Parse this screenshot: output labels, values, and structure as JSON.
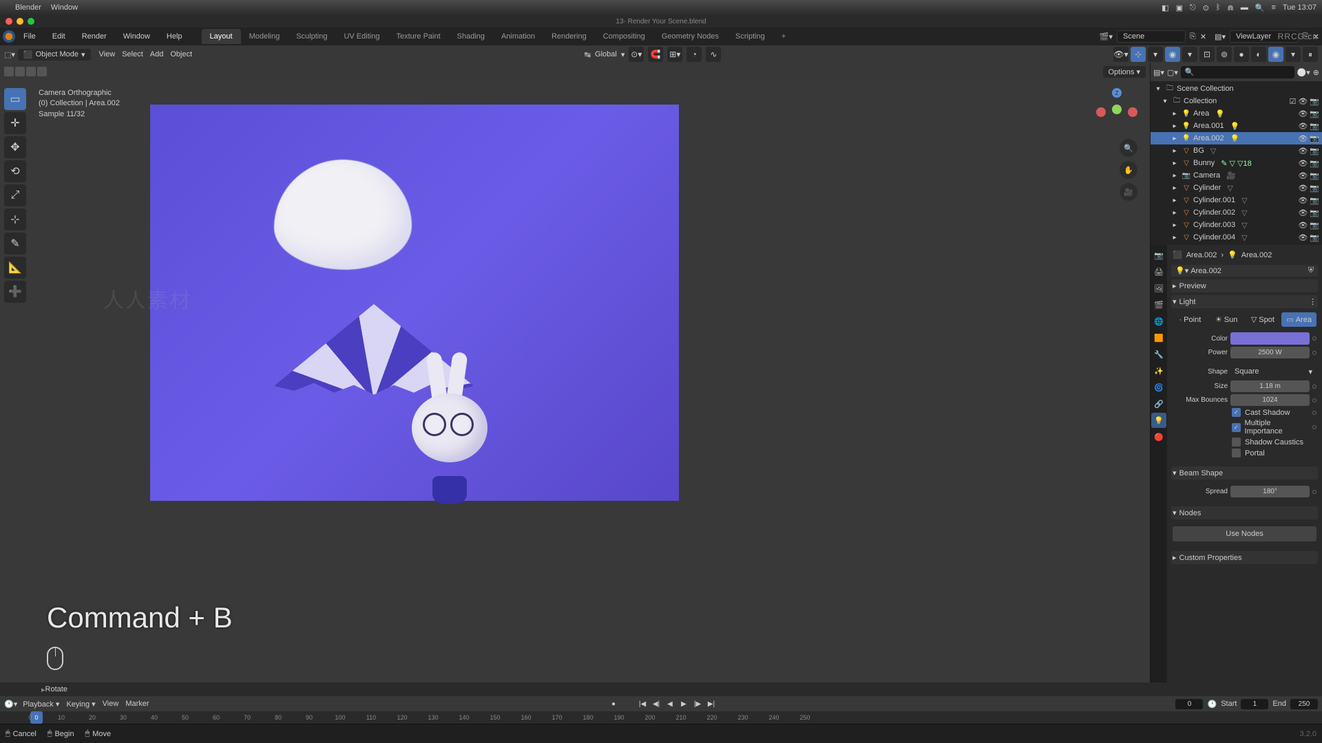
{
  "mac": {
    "app": "Blender",
    "window": "Window",
    "clock": "Tue 13:07"
  },
  "titlebar": {
    "filename": "13- Render Your Scene.blend"
  },
  "menus": {
    "file": "File",
    "edit": "Edit",
    "render": "Render",
    "window": "Window",
    "help": "Help"
  },
  "workspaces": [
    "Layout",
    "Modeling",
    "Sculpting",
    "UV Editing",
    "Texture Paint",
    "Shading",
    "Animation",
    "Rendering",
    "Compositing",
    "Geometry Nodes",
    "Scripting"
  ],
  "active_workspace": "Layout",
  "scene_field": "Scene",
  "viewlayer_field": "ViewLayer",
  "header": {
    "mode": "Object Mode",
    "view": "View",
    "select": "Select",
    "add": "Add",
    "object": "Object",
    "orientation": "Global",
    "options": "Options"
  },
  "overlay": {
    "line1": "Camera Orthographic",
    "line2": "(0) Collection | Area.002",
    "line3": "Sample 11/32"
  },
  "shortcut": "Command + B",
  "outliner": {
    "root": "Scene Collection",
    "collection": "Collection",
    "items": [
      {
        "name": "Area",
        "type": "light"
      },
      {
        "name": "Area.001",
        "type": "light"
      },
      {
        "name": "Area.002",
        "type": "light",
        "selected": true
      },
      {
        "name": "BG",
        "type": "mesh"
      },
      {
        "name": "Bunny",
        "type": "mesh",
        "extra": "18"
      },
      {
        "name": "Camera",
        "type": "camera"
      },
      {
        "name": "Cylinder",
        "type": "mesh"
      },
      {
        "name": "Cylinder.001",
        "type": "mesh"
      },
      {
        "name": "Cylinder.002",
        "type": "mesh"
      },
      {
        "name": "Cylinder.003",
        "type": "mesh"
      },
      {
        "name": "Cylinder.004",
        "type": "mesh"
      }
    ]
  },
  "props": {
    "breadcrumb1": "Area.002",
    "breadcrumb2": "Area.002",
    "data_name": "Area.002",
    "panels": {
      "preview": "Preview",
      "light": "Light",
      "beam": "Beam Shape",
      "nodes": "Nodes",
      "custom": "Custom Properties"
    },
    "light_types": [
      "Point",
      "Sun",
      "Spot",
      "Area"
    ],
    "active_light_type": "Area",
    "color_label": "Color",
    "power_label": "Power",
    "power_value": "2500 W",
    "shape_label": "Shape",
    "shape_value": "Square",
    "size_label": "Size",
    "size_value": "1.18 m",
    "bounces_label": "Max Bounces",
    "bounces_value": "1024",
    "cast_shadow": "Cast Shadow",
    "multiple_importance": "Multiple Importance",
    "shadow_caustics": "Shadow Caustics",
    "portal": "Portal",
    "spread_label": "Spread",
    "spread_value": "180°",
    "use_nodes": "Use Nodes"
  },
  "timeline": {
    "rotate": "Rotate",
    "playback": "Playback",
    "keying": "Keying",
    "view": "View",
    "marker": "Marker",
    "current": "0",
    "start_label": "Start",
    "start": "1",
    "end_label": "End",
    "end": "250",
    "ticks": [
      "0",
      "10",
      "20",
      "30",
      "40",
      "50",
      "60",
      "70",
      "80",
      "90",
      "100",
      "110",
      "120",
      "130",
      "140",
      "150",
      "160",
      "170",
      "180",
      "190",
      "200",
      "210",
      "220",
      "230",
      "240",
      "250"
    ]
  },
  "statusbar": {
    "cancel": "Cancel",
    "begin": "Begin",
    "move": "Move",
    "version": "3.2.0"
  },
  "watermark": "RRCG.cn"
}
